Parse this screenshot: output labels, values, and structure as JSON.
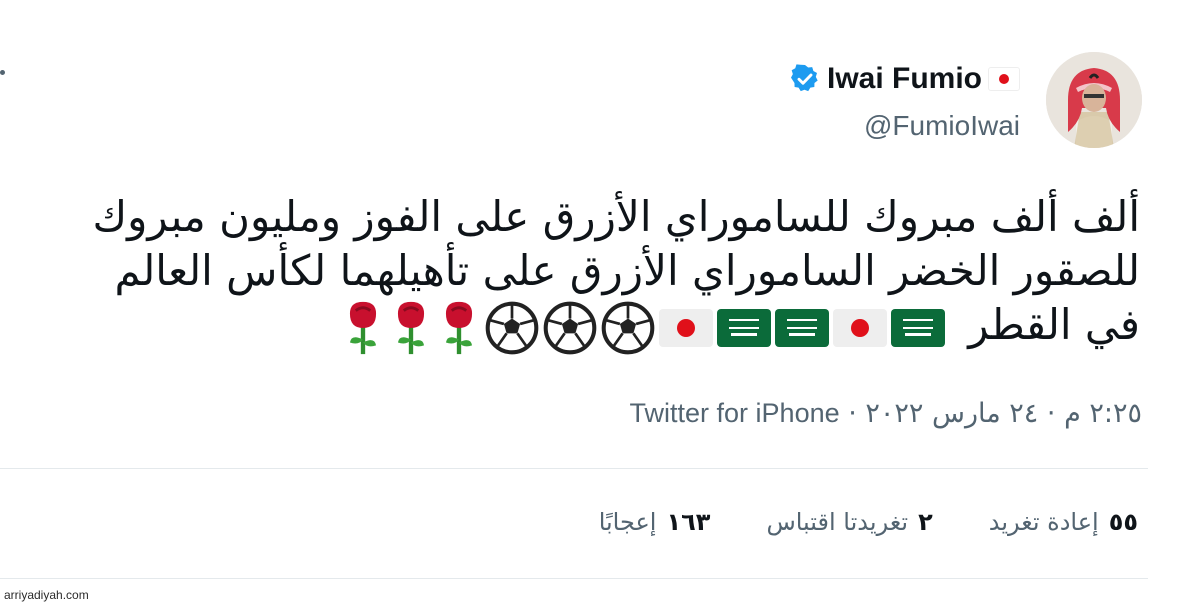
{
  "author": {
    "display_name": "Iwai Fumio",
    "handle": "@FumioIwai"
  },
  "tweet": {
    "lines": [
      "ألف ألف مبروك للساموراي الأزرق على الفوز ومليون مبروك",
      "للصقور الخضر الساموراي الأزرق على تأهيلهما لكأس العالم",
      "في القطر"
    ],
    "emojis": [
      "flag-sa",
      "flag-jp",
      "flag-sa",
      "flag-sa",
      "flag-jp",
      "soccer-ball",
      "soccer-ball",
      "soccer-ball",
      "rose",
      "rose",
      "rose"
    ]
  },
  "meta": {
    "time": "٢:٢٥ م",
    "date": "٢٤ مارس ٢٠٢٢",
    "separator": "·",
    "source": "Twitter for iPhone"
  },
  "stats": {
    "retweets_count": "٥٥",
    "retweets_label": "إعادة تغريد",
    "quotes_count": "٢",
    "quotes_label": "تغريدتا اقتباس",
    "likes_count": "١٦٣",
    "likes_label": "إعجابًا"
  },
  "watermark": "arriyadiyah.com",
  "colors": {
    "verified_blue": "#1d9bf0",
    "secondary_text": "#536471",
    "saudi_green": "#0b6b3a",
    "japan_red": "#e0101a"
  }
}
